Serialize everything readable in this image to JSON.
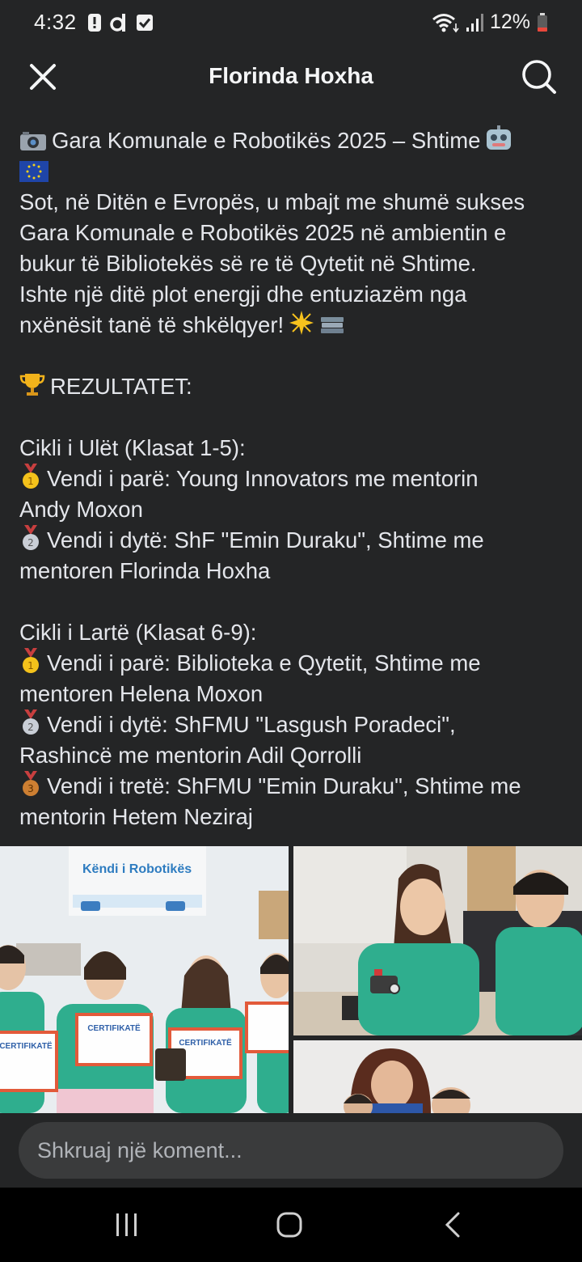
{
  "status_bar": {
    "time": "4:32",
    "battery": "12%",
    "icons": [
      "alert-icon",
      "d-app-icon",
      "check-box-icon",
      "wifi-icon",
      "signal-icon",
      "battery-icon"
    ]
  },
  "header": {
    "title": "Florinda Hoxha",
    "icons": [
      "close-icon",
      "search-icon"
    ]
  },
  "post": {
    "title_line": "Gara Komunale e Robotikës 2025 – Shtime",
    "lines": [
      "Sot, në Ditën e Evropës, u mbajt me shumë sukses",
      "Gara Komunale e Robotikës 2025 në ambientin e",
      "bukur të Bibliotekës së re të Qytetit në Shtime.",
      "Ishte një ditë plot energji dhe entuziazëm nga",
      "nxënësit tanë të shkëlqyer!"
    ],
    "results_heading": "REZULTATET:",
    "lower_cycle": {
      "heading": "Cikli i Ulët (Klasat 1-5):",
      "first_a": "Vendi i parë: Young Innovators me mentorin",
      "first_b": "Andy Moxon",
      "second_a": "Vendi i dytë: ShF \"Emin Duraku\", Shtime me",
      "second_b": "mentoren Florinda Hoxha"
    },
    "upper_cycle": {
      "heading": "Cikli i Lartë (Klasat 6-9):",
      "first_a": "Vendi i parë: Biblioteka e Qytetit, Shtime me",
      "first_b": "mentoren Helena Moxon",
      "second_a": "Vendi i dytë: ShFMU \"Lasgush Poradeci\",",
      "second_b": "Rashincë me mentorin Adil Qorrolli",
      "third_a": "Vendi i tretë: ShFMU \"Emin Duraku\", Shtime me",
      "third_b": "mentorin Hetem Neziraj"
    },
    "emojis": [
      "camera-emoji",
      "robot-emoji",
      "eu-flag-emoji",
      "sparkle-emoji",
      "books-emoji",
      "trophy-emoji",
      "gold-medal-emoji",
      "silver-medal-emoji",
      "bronze-medal-emoji"
    ]
  },
  "photos": {
    "banner_text": "Këndi i Robotikës",
    "certificate_label": "CERTIFIKATË"
  },
  "comment": {
    "placeholder": "Shkruaj një koment..."
  },
  "colors": {
    "background": "#242526",
    "text": "#e4e6eb",
    "input_bg": "#3a3b3c",
    "shirt_green": "#2fae8e",
    "gold": "#f4c21b",
    "silver": "#c9ced6",
    "bronze": "#cd7f32"
  }
}
